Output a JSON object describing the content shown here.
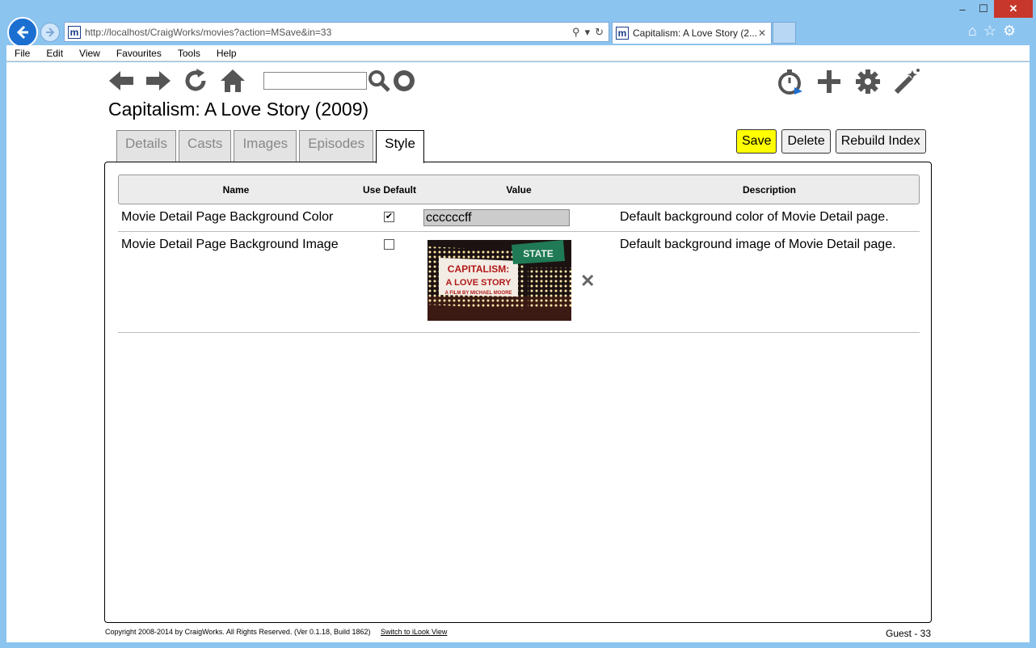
{
  "browser": {
    "url": "http://localhost/CraigWorks/movies?action=MSave&in=33",
    "tab_title": "Capitalism: A Love Story (2...",
    "favicon_letter": "m",
    "window_controls": [
      "minimize",
      "maximize",
      "close"
    ]
  },
  "menu": [
    "File",
    "Edit",
    "View",
    "Favourites",
    "Tools",
    "Help"
  ],
  "toolbar": {
    "left_icons": [
      "back-arrow-icon",
      "forward-arrow-icon",
      "refresh-icon",
      "home-icon"
    ],
    "search_value": "",
    "right_icons": [
      "timer-icon",
      "add-icon",
      "gear-icon",
      "magic-wand-icon"
    ]
  },
  "page": {
    "title": "Capitalism: A Love Story (2009)",
    "tabs": [
      {
        "label": "Details",
        "active": false
      },
      {
        "label": "Casts",
        "active": false
      },
      {
        "label": "Images",
        "active": false
      },
      {
        "label": "Episodes",
        "active": false
      },
      {
        "label": "Style",
        "active": true
      }
    ],
    "buttons": {
      "save": "Save",
      "delete": "Delete",
      "rebuild": "Rebuild Index"
    }
  },
  "grid": {
    "headers": {
      "name": "Name",
      "use_default": "Use Default",
      "value": "Value",
      "description": "Description"
    },
    "rows": [
      {
        "name": "Movie Detail Page Background Color",
        "use_default": true,
        "value": "ccccccff",
        "description": "Default background color of Movie Detail page."
      },
      {
        "name": "Movie Detail Page Background Image",
        "use_default": false,
        "value_image": "CAPITALISM: A LOVE STORY — A FILM BY MICHAEL MOORE",
        "description": "Default background image of Movie Detail page."
      }
    ]
  },
  "footer": {
    "copyright": "Copyright 2008-2014 by CraigWorks. All Rights Reserved. (Ver 0.1.18, Build 1862)",
    "link": "Switch to iLook View",
    "user": "Guest - 33"
  },
  "colors": {
    "save_button": "#ffff00",
    "value_input": "#cccccc",
    "chrome": "#8cc4f0"
  }
}
